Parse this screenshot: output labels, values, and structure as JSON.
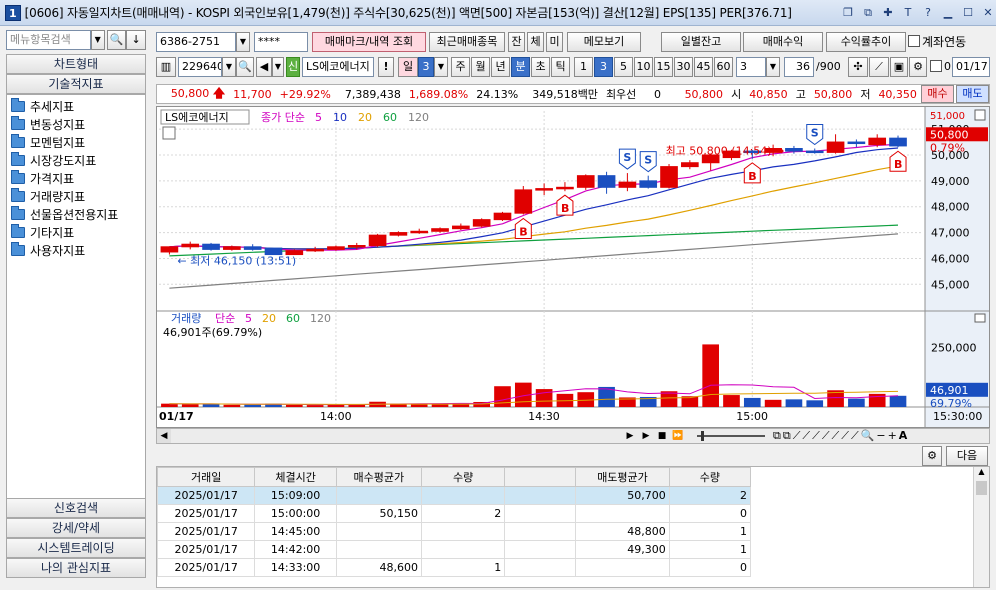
{
  "window": {
    "title": "[0606] 자동일지차트(매매내역) - KOSPI 외국인보유[1,479(천)] 주식수[30,625(천)] 액면[500] 자본금[153(억)] 결산[12월] EPS[135] PER[376.71]",
    "app_icon_label": "1"
  },
  "toolbar1": {
    "account": "6386-2751",
    "password": "****",
    "btn_trade_mark": "매매마크/내역 조회",
    "btn_recent": "최근매매종목",
    "btn_jan": "잔",
    "btn_che": "체",
    "btn_mi": "미",
    "btn_memo": "메모보기",
    "btn_daily": "일별잔고",
    "btn_profit": "매매수익",
    "btn_curve": "수익률추이",
    "chk_account": "계좌연동"
  },
  "toolbar2": {
    "code": "229640",
    "credit_badge": "신",
    "stock_name": "LS에코에너지",
    "warn": "!",
    "period_sel": "일",
    "period_num": "3",
    "periods": [
      "주",
      "월",
      "년",
      "분",
      "초",
      "틱"
    ],
    "minutes": [
      "1",
      "3",
      "5",
      "10",
      "15",
      "30",
      "45",
      "60"
    ],
    "interval": "3",
    "count": "36",
    "count_total": "/900",
    "date": "01/17"
  },
  "info": {
    "price": "50,800",
    "change": "11,700",
    "change_pct": "+29.92%",
    "volume": "7,389,438",
    "vol_ratio": "1,689.08%",
    "turnover": "24.13%",
    "amount": "349,518백만",
    "priority_label": "최우선",
    "priority_value": "0",
    "last": "50,800",
    "open_label": "시",
    "open": "40,850",
    "high_label": "고",
    "high": "50,800",
    "low_label": "저",
    "low": "40,350",
    "buy_label": "매수",
    "sell_label": "매도"
  },
  "chart_data": {
    "type": "candlestick",
    "price_legend": {
      "name": "LS에코에너지",
      "ma_label": "종가 단순",
      "periods": [
        "5",
        "10",
        "20",
        "60",
        "120"
      ]
    },
    "volume_legend": {
      "name": "거래량",
      "ma_label": "단순",
      "periods": [
        "5",
        "20",
        "60",
        "120"
      ],
      "readout": "46,901주(69.79%)"
    },
    "price_axis": {
      "range": [
        44200,
        51700
      ],
      "ticks": [
        "51,000",
        "50,000",
        "49,000",
        "48,000",
        "47,000",
        "46,000",
        "45,000"
      ],
      "top_tick": "51,000",
      "last_label": "50,800",
      "last_pct": "0.79%"
    },
    "volume_axis": {
      "max": 360000,
      "ticks": [
        "250,000"
      ],
      "last_label": "46,901",
      "last_pct": "69.79%"
    },
    "x_labels": [
      "01/17",
      "14:00",
      "14:30",
      "15:00",
      "15:30:00"
    ],
    "x_label_slots": [
      0,
      8.5,
      18.5,
      28.5,
      38.5
    ],
    "annotations": {
      "high": "최고 50,800 (14:54)",
      "low": "최저 46,150 (13:51)"
    },
    "candles": [
      {
        "o": 46250,
        "h": 46450,
        "l": 46150,
        "c": 46450,
        "v": 14000
      },
      {
        "o": 46450,
        "h": 46650,
        "l": 46350,
        "c": 46550,
        "v": 12000
      },
      {
        "o": 46550,
        "h": 46600,
        "l": 46300,
        "c": 46350,
        "v": 13000
      },
      {
        "o": 46350,
        "h": 46500,
        "l": 46300,
        "c": 46450,
        "v": 9000
      },
      {
        "o": 46450,
        "h": 46550,
        "l": 46300,
        "c": 46350,
        "v": 10000
      },
      {
        "o": 46400,
        "h": 46400,
        "l": 46150,
        "c": 46150,
        "v": 14000
      },
      {
        "o": 46150,
        "h": 46350,
        "l": 46150,
        "c": 46300,
        "v": 9000
      },
      {
        "o": 46300,
        "h": 46450,
        "l": 46250,
        "c": 46350,
        "v": 8000
      },
      {
        "o": 46350,
        "h": 46500,
        "l": 46300,
        "c": 46450,
        "v": 9000
      },
      {
        "o": 46450,
        "h": 46600,
        "l": 46350,
        "c": 46500,
        "v": 10000
      },
      {
        "o": 46500,
        "h": 46950,
        "l": 46450,
        "c": 46900,
        "v": 22000
      },
      {
        "o": 46900,
        "h": 47050,
        "l": 46850,
        "c": 47000,
        "v": 14000
      },
      {
        "o": 47000,
        "h": 47150,
        "l": 46950,
        "c": 47050,
        "v": 12000
      },
      {
        "o": 47050,
        "h": 47200,
        "l": 47000,
        "c": 47150,
        "v": 13000
      },
      {
        "o": 47150,
        "h": 47350,
        "l": 47100,
        "c": 47250,
        "v": 14000
      },
      {
        "o": 47250,
        "h": 47550,
        "l": 47200,
        "c": 47500,
        "v": 21000
      },
      {
        "o": 47500,
        "h": 47800,
        "l": 47450,
        "c": 47750,
        "v": 87000
      },
      {
        "o": 47750,
        "h": 48800,
        "l": 47700,
        "c": 48650,
        "v": 102000
      },
      {
        "o": 48650,
        "h": 48900,
        "l": 48450,
        "c": 48700,
        "v": 75000
      },
      {
        "o": 48700,
        "h": 48950,
        "l": 48600,
        "c": 48750,
        "v": 55000
      },
      {
        "o": 48750,
        "h": 49250,
        "l": 48650,
        "c": 49200,
        "v": 62000
      },
      {
        "o": 49200,
        "h": 49350,
        "l": 48500,
        "c": 48750,
        "v": 84000
      },
      {
        "o": 48750,
        "h": 49300,
        "l": 48600,
        "c": 48950,
        "v": 40000
      },
      {
        "o": 49000,
        "h": 49200,
        "l": 48700,
        "c": 48750,
        "v": 42000
      },
      {
        "o": 48750,
        "h": 49650,
        "l": 48700,
        "c": 49550,
        "v": 66000
      },
      {
        "o": 49550,
        "h": 49800,
        "l": 49450,
        "c": 49700,
        "v": 45000
      },
      {
        "o": 49700,
        "h": 50050,
        "l": 49400,
        "c": 50000,
        "v": 262000
      },
      {
        "o": 49900,
        "h": 50200,
        "l": 49800,
        "c": 50150,
        "v": 50000
      },
      {
        "o": 50150,
        "h": 50200,
        "l": 49850,
        "c": 50100,
        "v": 38000
      },
      {
        "o": 50100,
        "h": 50400,
        "l": 49950,
        "c": 50250,
        "v": 30000
      },
      {
        "o": 50250,
        "h": 50350,
        "l": 50050,
        "c": 50150,
        "v": 32000
      },
      {
        "o": 50150,
        "h": 50250,
        "l": 50050,
        "c": 50100,
        "v": 28000
      },
      {
        "o": 50100,
        "h": 50800,
        "l": 50050,
        "c": 50500,
        "v": 70000
      },
      {
        "o": 50500,
        "h": 50600,
        "l": 50300,
        "c": 50450,
        "v": 35000
      },
      {
        "o": 50400,
        "h": 50800,
        "l": 50300,
        "c": 50650,
        "v": 55000
      },
      {
        "o": 50650,
        "h": 50750,
        "l": 50300,
        "c": 50350,
        "v": 46901
      }
    ],
    "marks": [
      {
        "i": 17,
        "side": "buy",
        "label": "B"
      },
      {
        "i": 19,
        "side": "buy",
        "label": "B"
      },
      {
        "i": 22,
        "side": "sell",
        "label": "S"
      },
      {
        "i": 23,
        "side": "sell",
        "label": "S"
      },
      {
        "i": 28,
        "side": "buy",
        "label": "B"
      },
      {
        "i": 31,
        "side": "sell",
        "label": "S"
      },
      {
        "i": 35,
        "side": "buy",
        "label": "B"
      }
    ]
  },
  "grid": {
    "headers": [
      "거래일",
      "체결시간",
      "매수평균가",
      "수량",
      "",
      "매도평균가",
      "수량"
    ],
    "next_label": "다음",
    "rows": [
      [
        "2025/01/17",
        "15:09:00",
        "",
        "",
        "",
        "50,700",
        "2"
      ],
      [
        "2025/01/17",
        "15:00:00",
        "50,150",
        "2",
        "",
        "",
        "0"
      ],
      [
        "2025/01/17",
        "14:45:00",
        "",
        "",
        "",
        "48,800",
        "1"
      ],
      [
        "2025/01/17",
        "14:42:00",
        "",
        "",
        "",
        "49,300",
        "1"
      ],
      [
        "2025/01/17",
        "14:33:00",
        "48,600",
        "1",
        "",
        "",
        "0"
      ]
    ]
  },
  "sidebar": {
    "search_placeholder": "메뉴항목검색",
    "sections_top": [
      "차트형태",
      "기술적지표"
    ],
    "items": [
      "추세지표",
      "변동성지표",
      "모멘텀지표",
      "시장강도지표",
      "가격지표",
      "거래량지표",
      "선물옵션전용지표",
      "기타지표",
      "사용자지표"
    ],
    "sections_bottom": [
      "신호검색",
      "강세/약세",
      "시스템트레이딩",
      "나의 관심지표"
    ]
  },
  "colors": {
    "up": "#e00000",
    "down": "#1a4fc0",
    "ma5": "#d000c0",
    "ma10": "#1a30c0",
    "ma20": "#e0a000",
    "ma60": "#10a040",
    "ma120": "#808080"
  }
}
